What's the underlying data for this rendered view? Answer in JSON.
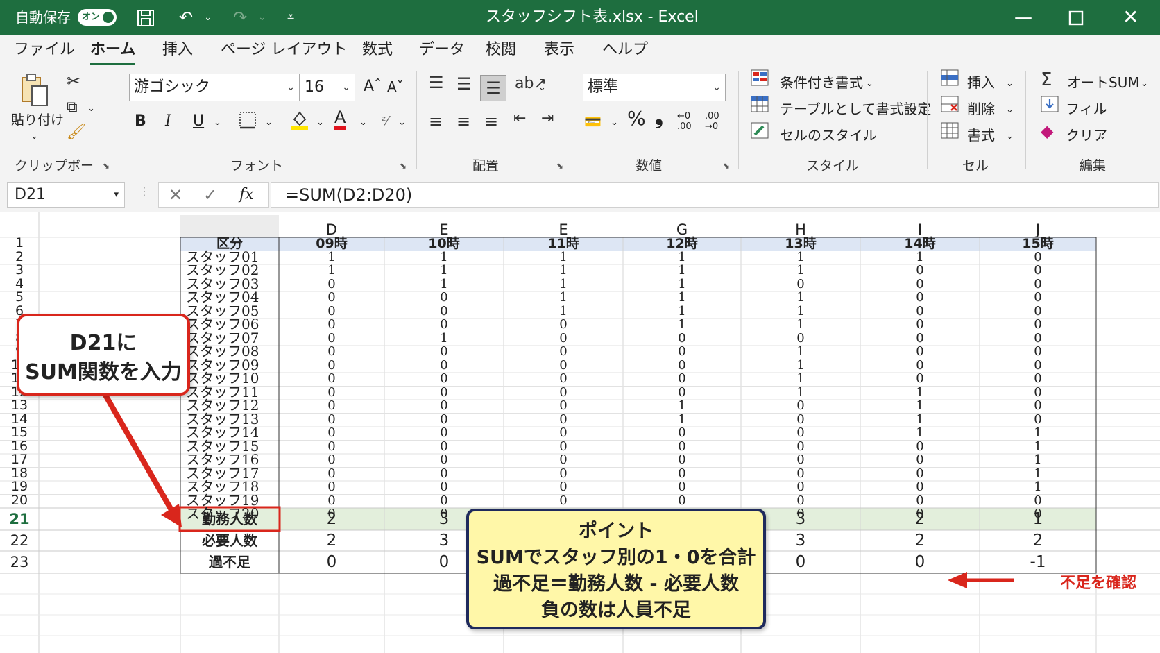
{
  "titlebar": {
    "autosave_label": "自動保存",
    "autosave_toggle": "オン",
    "title": "スタッフシフト表.xlsx  -  Excel"
  },
  "menu": [
    "ファイル",
    "ホーム",
    "挿入",
    "ページ レイアウト",
    "数式",
    "データ",
    "校閲",
    "表示",
    "ヘルプ"
  ],
  "ribbon": {
    "clipboard": {
      "paste": "貼り付け",
      "label": "クリップボード"
    },
    "font": {
      "name": "游ゴシック",
      "size": "16",
      "bold": "B",
      "italic": "I",
      "underline": "U",
      "font_color_glyph": "A",
      "label": "フォント"
    },
    "alignment": {
      "label": "配置"
    },
    "number": {
      "format": "標準",
      "percent": "%",
      "comma": "❟",
      "inc_dec": "←0\n.00",
      "label": "数値"
    },
    "styles": {
      "conditional": "条件付き書式",
      "table": "テーブルとして書式設定",
      "cell_styles": "セルのスタイル",
      "label": "スタイル"
    },
    "cells": {
      "insert": "挿入",
      "delete": "削除",
      "format": "書式",
      "label": "セル"
    },
    "editing": {
      "autosum": "オートSUM",
      "fill": "フィル",
      "clear": "クリア",
      "label": "編集"
    }
  },
  "formula_bar": {
    "name_box": "D21",
    "fx": "fx",
    "formula": "=SUM(D2:D20)"
  },
  "sheet": {
    "col_letters": [
      "D",
      "E",
      "E",
      "G",
      "H",
      "I",
      "J"
    ],
    "header_label": "区分",
    "hours": [
      "09時",
      "10時",
      "11時",
      "12時",
      "13時",
      "14時",
      "15時"
    ],
    "staff": [
      "スタッフ01",
      "スタッフ02",
      "スタッフ03",
      "スタッフ04",
      "スタッフ05",
      "スタッフ06",
      "スタッフ07",
      "スタッフ08",
      "スタッフ09",
      "スタッフ10",
      "スタッフ11",
      "スタッフ12",
      "スタッフ13",
      "スタッフ14",
      "スタッフ15",
      "スタッフ16",
      "スタッフ17",
      "スタッフ18",
      "スタッフ19",
      "スタッフ20"
    ],
    "values": [
      [
        "1",
        "1",
        "1",
        "1",
        "1",
        "1",
        "0"
      ],
      [
        "1",
        "1",
        "1",
        "1",
        "1",
        "0",
        "0"
      ],
      [
        "0",
        "1",
        "1",
        "1",
        "0",
        "0",
        "0"
      ],
      [
        "0",
        "0",
        "1",
        "1",
        "1",
        "0",
        "0"
      ],
      [
        "0",
        "0",
        "1",
        "1",
        "1",
        "0",
        "0"
      ],
      [
        "0",
        "0",
        "0",
        "1",
        "1",
        "0",
        "0"
      ],
      [
        "0",
        "1",
        "0",
        "0",
        "0",
        "0",
        "0"
      ],
      [
        "0",
        "0",
        "0",
        "0",
        "1",
        "0",
        "0"
      ],
      [
        "0",
        "0",
        "0",
        "0",
        "1",
        "0",
        "0"
      ],
      [
        "0",
        "0",
        "0",
        "0",
        "1",
        "0",
        "0"
      ],
      [
        "0",
        "0",
        "0",
        "0",
        "1",
        "1",
        "0"
      ],
      [
        "0",
        "0",
        "0",
        "1",
        "0",
        "1",
        "0"
      ],
      [
        "0",
        "0",
        "0",
        "1",
        "0",
        "1",
        "0"
      ],
      [
        "0",
        "0",
        "0",
        "0",
        "0",
        "1",
        "1"
      ],
      [
        "0",
        "0",
        "0",
        "0",
        "0",
        "0",
        "1"
      ],
      [
        "0",
        "0",
        "0",
        "0",
        "0",
        "0",
        "1"
      ],
      [
        "0",
        "0",
        "0",
        "0",
        "0",
        "0",
        "1"
      ],
      [
        "0",
        "0",
        "0",
        "0",
        "0",
        "0",
        "1"
      ],
      [
        "0",
        "0",
        "0",
        "0",
        "0",
        "0",
        "0"
      ],
      [
        "0",
        "0",
        "0",
        "0",
        "0",
        "0",
        "0"
      ]
    ],
    "summary_labels": [
      "勤務人数",
      "必要人数",
      "過不足"
    ],
    "summary": [
      [
        "2",
        "3",
        "",
        "",
        "3",
        "2",
        "1"
      ],
      [
        "2",
        "3",
        "",
        "",
        "3",
        "2",
        "2"
      ],
      [
        "0",
        "0",
        "",
        "",
        "0",
        "0",
        "-1"
      ]
    ]
  },
  "callouts": {
    "left": {
      "line1": "D21に",
      "line2": "SUM関数を入力"
    },
    "point": {
      "title": "ポイント",
      "line1": "SUMでスタッフ別の1・0を合計",
      "line2": "過不足＝勤務人数 - 必要人数",
      "line3": "負の数は人員不足"
    },
    "shortage": "不足を確認"
  },
  "colors": {
    "excel_green": "#1e6e3f",
    "callout_red": "#d9261c",
    "note_yellow": "#fff7a8",
    "note_border": "#1f2a5c",
    "header_blue": "#dde6f4",
    "selected_row": "#e3efdc"
  }
}
